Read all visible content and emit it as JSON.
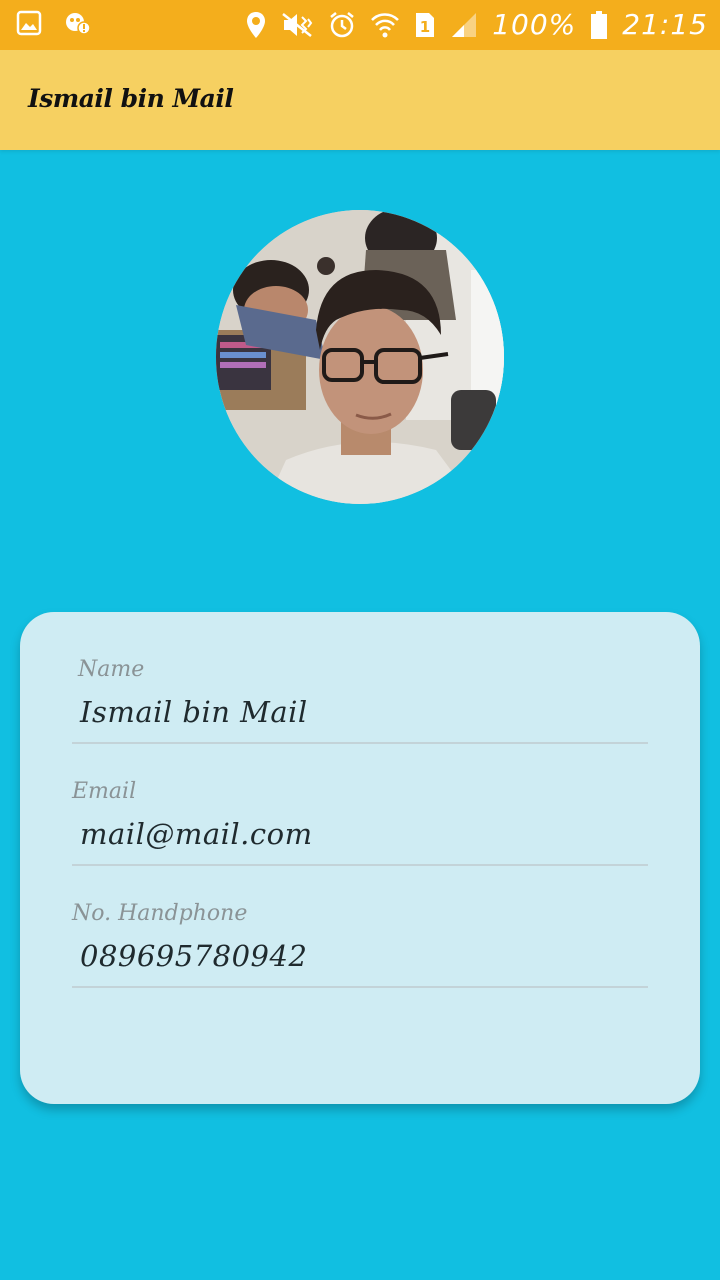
{
  "status_bar": {
    "battery": "100%",
    "time": "21:15",
    "sim_slot": "1"
  },
  "app_bar": {
    "title": "Ismail bin Mail"
  },
  "profile": {
    "avatar_icon": "profile-photo"
  },
  "form": {
    "name": {
      "label": "Name",
      "value": "Ismail bin Mail"
    },
    "email": {
      "label": "Email",
      "value": "mail@mail.com"
    },
    "phone": {
      "label": "No. Handphone",
      "value": "089695780942"
    }
  },
  "colors": {
    "status_bar": "#f4ae1c",
    "app_bar": "#f6d061",
    "background": "#11bfe1",
    "card": "#cfecf3"
  }
}
